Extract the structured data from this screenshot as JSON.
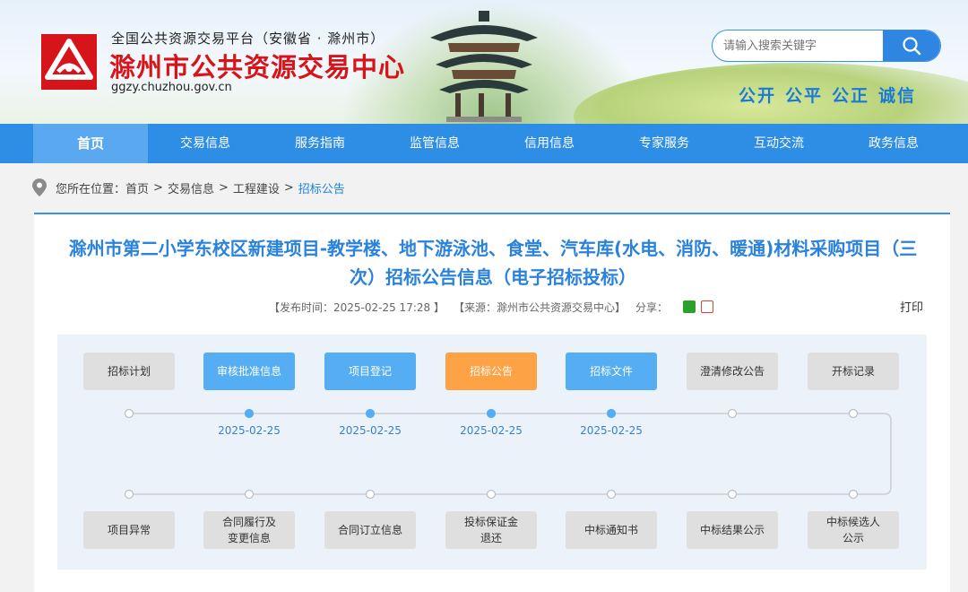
{
  "header": {
    "subtitle": "全国公共资源交易平台（安徽省 · 滁州市）",
    "title": "滁州市公共资源交易中心",
    "url": "ggzy.chuzhou.gov.cn",
    "search_placeholder": "请输入搜索关键字",
    "slogans": [
      "公开",
      "公平",
      "公正",
      "诚信"
    ]
  },
  "nav": {
    "items": [
      "首页",
      "交易信息",
      "服务指南",
      "监管信息",
      "信用信息",
      "专家服务",
      "互动交流",
      "政务信息"
    ],
    "active": "首页"
  },
  "breadcrumb": {
    "prefix": "您所在位置：",
    "items": [
      "首页",
      "交易信息",
      "工程建设",
      "招标公告"
    ],
    "separator": ">"
  },
  "article": {
    "title": "滁州市第二小学东校区新建项目-教学楼、地下游泳池、食堂、汽车库(水电、消防、暖通)材料采购项目（三次）招标公告信息（电子招标投标）",
    "publish_time": "【发布时间：2025-02-25 17:28 】",
    "source": "【来源：滁州市公共资源交易中心】",
    "share_label": "分享：",
    "print_label": "打印"
  },
  "process": {
    "top_steps": [
      {
        "label": "招标计划",
        "state": "inactive",
        "date": ""
      },
      {
        "label": "审核批准信息",
        "state": "done",
        "date": "2025-02-25"
      },
      {
        "label": "项目登记",
        "state": "done",
        "date": "2025-02-25"
      },
      {
        "label": "招标公告",
        "state": "current",
        "date": "2025-02-25"
      },
      {
        "label": "招标文件",
        "state": "done",
        "date": "2025-02-25"
      },
      {
        "label": "澄清修改公告",
        "state": "inactive",
        "date": ""
      },
      {
        "label": "开标记录",
        "state": "inactive",
        "date": ""
      }
    ],
    "bottom_steps": [
      {
        "label": "项目异常",
        "state": "inactive"
      },
      {
        "label": "合同履行及\n变更信息",
        "state": "inactive"
      },
      {
        "label": "合同订立信息",
        "state": "inactive"
      },
      {
        "label": "投标保证金\n退还",
        "state": "inactive"
      },
      {
        "label": "中标通知书",
        "state": "inactive"
      },
      {
        "label": "中标结果公示",
        "state": "inactive"
      },
      {
        "label": "中标候选人\n公示",
        "state": "inactive"
      }
    ],
    "colors": {
      "done": "#55aef4",
      "current": "#fea246",
      "inactive": "#dfdfdf",
      "line": "#c9ced4"
    }
  }
}
